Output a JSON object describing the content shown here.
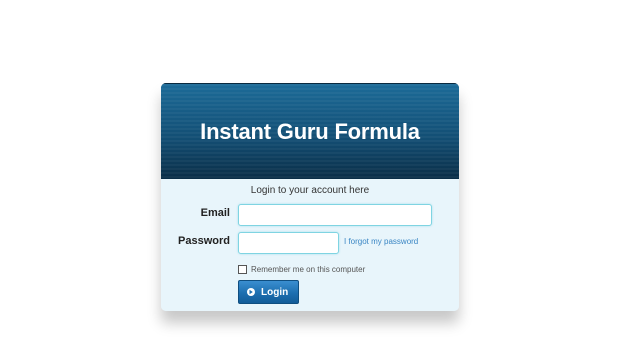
{
  "header": {
    "title": "Instant Guru Formula"
  },
  "form": {
    "subtitle": "Login to your account here",
    "email_label": "Email",
    "email_value": "",
    "password_label": "Password",
    "password_value": "",
    "forgot_link": "I forgot my password",
    "remember_label": "Remember me on this computer",
    "remember_checked": false,
    "login_button": "Login",
    "login_icon": "arrow-right-circle-icon"
  },
  "colors": {
    "header_top": "#1c6b98",
    "header_bottom": "#0a2d46",
    "body_background": "#e8f5fb",
    "input_border": "#7fd4e2",
    "link": "#3a86c4",
    "button": "#1d6fb0"
  }
}
